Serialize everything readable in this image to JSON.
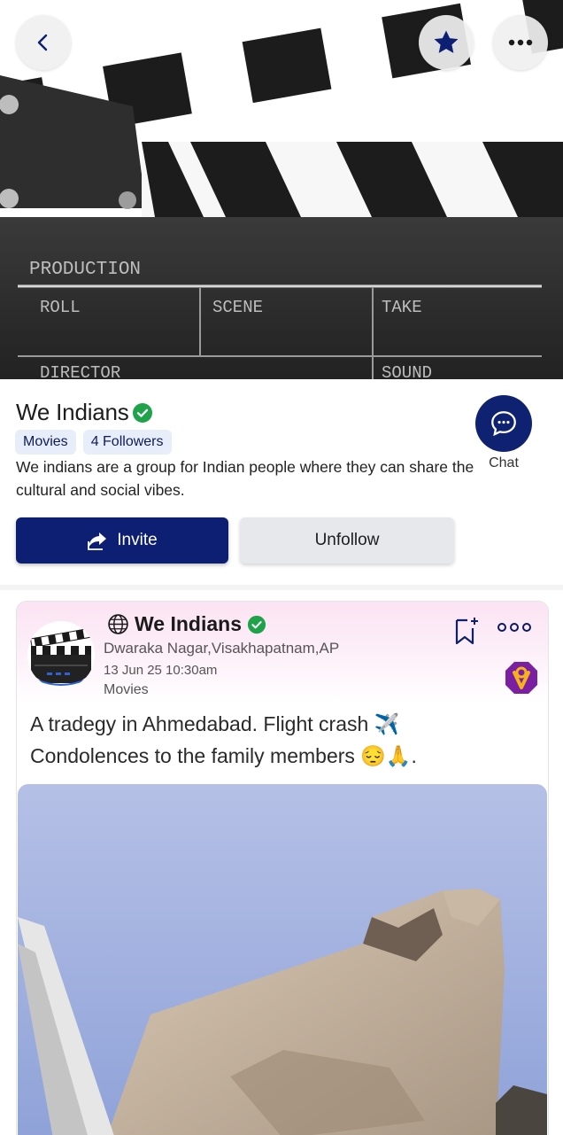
{
  "header": {
    "back_icon": "chevron-left-icon",
    "favorite_icon": "star-icon",
    "more_icon": "more-horizontal-icon",
    "cover_image": "film-clapperboard",
    "clapper_text": {
      "production": "PRODUCTION",
      "roll": "ROLL",
      "scene": "SCENE",
      "take": "TAKE",
      "director": "DIRECTOR",
      "sound": "SOUND"
    }
  },
  "group": {
    "name": "We Indians",
    "verified": true,
    "category": "Movies",
    "followers": "4 Followers",
    "description": "We indians are a group for Indian people where they can share the cultural and social vibes.",
    "chat_label": "Chat",
    "invite_label": "Invite",
    "unfollow_label": "Unfollow"
  },
  "post": {
    "group_name": "We Indians",
    "location": "Dwaraka Nagar,Visakhapatnam,AP",
    "timestamp": "13 Jun 25 10:30am",
    "category": "Movies",
    "text_line1": "A tradegy in Ahmedabad. Flight crash ✈️",
    "text_line2": "Condolences to the family members 😔🙏.",
    "image": "aircraft-wreckage-photo"
  },
  "colors": {
    "primary": "#0c1f72",
    "chip_bg": "#e8eef9",
    "verified": "#1fa34a",
    "post_header_bg": "#fbe3f3",
    "unfollow_bg": "#e6e8ec"
  }
}
